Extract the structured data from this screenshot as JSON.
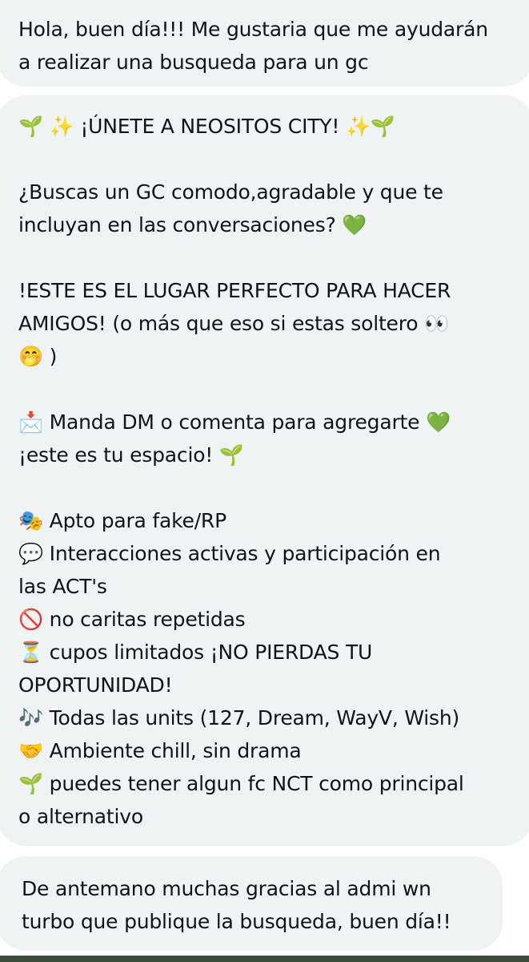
{
  "messages": [
    {
      "lines": [
        "Hola, buen día!!! Me gustaria que me ayudarán",
        "a realizar una busqueda para un gc"
      ]
    },
    {
      "blocks": [
        [
          "🌱 ✨ ¡ÚNETE A NEOSITOS CITY! ✨🌱"
        ],
        [
          "¿Buscas un GC comodo,agradable y que te",
          "incluyan en las conversaciones?  💚"
        ],
        [
          "!ESTE ES EL LUGAR PERFECTO PARA HACER",
          "AMIGOS! (o más que eso si estas soltero 👀",
          "🤭 )"
        ],
        [
          "📩 Manda DM o comenta para agregarte 💚",
          "¡este es tu espacio! 🌱"
        ],
        [
          "🎭 Apto para fake/RP",
          "💬 Interacciones activas y participación en",
          "las ACT's",
          "🚫 no caritas repetidas",
          "⏳ cupos limitados ¡NO PIERDAS TU",
          "OPORTUNIDAD!",
          "🎶 Todas las units (127, Dream, WayV, Wish)",
          "🤝 Ambiente chill, sin drama",
          "🌱 puedes tener algun fc NCT como principal",
          "o alternativo"
        ]
      ]
    },
    {
      "lines": [
        "De antemano muchas gracias al admi wn",
        "turbo que publique la busqueda, buen día!!"
      ]
    }
  ],
  "colors": {
    "bubble_background": "#eff3f4",
    "text": "#0f1419",
    "page_background": "#ffffff"
  }
}
